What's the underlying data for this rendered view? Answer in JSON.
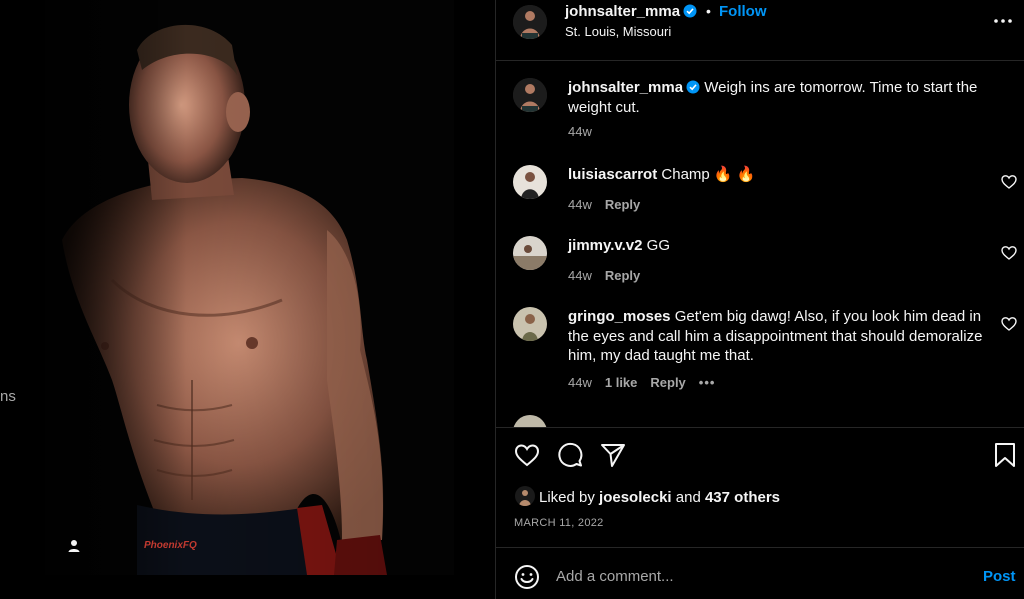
{
  "photo": {
    "side_text": "ns",
    "tag_icon": "person-tag-icon",
    "shorts_text": "PhoenixFQ"
  },
  "header": {
    "username": "johnsalter_mma",
    "separator": "•",
    "follow_label": "Follow",
    "location": "St. Louis, Missouri",
    "more_icon": "more-horizontal-icon"
  },
  "caption": {
    "username": "johnsalter_mma",
    "text": "Weigh ins are tomorrow. Time to start the weight cut.",
    "time": "44w"
  },
  "comments": [
    {
      "username": "luisiascarrot",
      "text": "Champ 🔥 🔥",
      "time": "44w",
      "reply": "Reply"
    },
    {
      "username": "jimmy.v.v2",
      "text": "GG",
      "time": "44w",
      "reply": "Reply"
    },
    {
      "username": "gringo_moses",
      "text": "Get'em big dawg! Also, if you look him dead in the eyes and call him a disappointment that should demoralize him, my dad taught me that.",
      "time": "44w",
      "likes": "1 like",
      "reply": "Reply",
      "more": "•••"
    }
  ],
  "actions": {
    "liked_by_prefix": "Liked by",
    "liked_by_user": "joesolecki",
    "liked_by_and": "and",
    "liked_by_others": "437 others",
    "date": "MARCH 11, 2022"
  },
  "composer": {
    "placeholder": "Add a comment...",
    "post_label": "Post"
  },
  "colors": {
    "accent": "#0095f6",
    "secondary_text": "#a8a8a8",
    "divider": "#262626",
    "background": "#000000"
  }
}
